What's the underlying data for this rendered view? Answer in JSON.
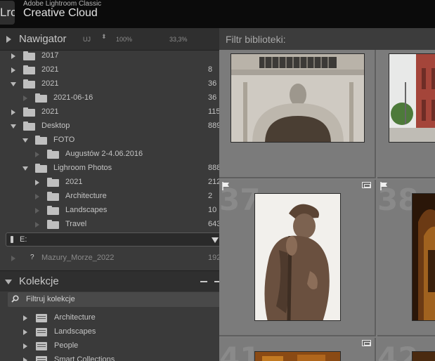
{
  "app": {
    "logo": "Lrc",
    "subtitle": "Adobe Lightroom Classic",
    "title": "Creative Cloud"
  },
  "navigator": {
    "title": "Nawigator",
    "fit": "UJ",
    "arrows": "⬍",
    "zoom1": "100%",
    "zoom2": "33,3%"
  },
  "folders": [
    {
      "label": "2017",
      "count": "",
      "level": 1,
      "expander": "collapsed"
    },
    {
      "label": "2021",
      "count": "8",
      "level": 1,
      "expander": "collapsed"
    },
    {
      "label": "2021",
      "count": "36",
      "level": 1,
      "expander": "expanded"
    },
    {
      "label": "2021-06-16",
      "count": "36",
      "level": 2,
      "expander": "none"
    },
    {
      "label": "2021",
      "count": "115",
      "level": 1,
      "expander": "collapsed"
    },
    {
      "label": "Desktop",
      "count": "889",
      "level": 1,
      "expander": "expanded"
    },
    {
      "label": "FOTO",
      "count": "",
      "level": 2,
      "expander": "expanded"
    },
    {
      "label": "Augustów 2-4.06.2016",
      "count": "",
      "level": 3,
      "expander": "none"
    },
    {
      "label": "Lighroom Photos",
      "count": "888",
      "level": 2,
      "expander": "expanded"
    },
    {
      "label": "2021",
      "count": "212",
      "level": 3,
      "expander": "collapsed"
    },
    {
      "label": "Architecture",
      "count": "2",
      "level": 3,
      "expander": "none"
    },
    {
      "label": "Landscapes",
      "count": "10",
      "level": 3,
      "expander": "none"
    },
    {
      "label": "Travel",
      "count": "643",
      "level": 3,
      "expander": "none"
    }
  ],
  "volume": {
    "label": "E:"
  },
  "missing_folder": {
    "label": "Mazury_Morze_2022",
    "count": "192"
  },
  "collections": {
    "title": "Kolekcje",
    "filter_label": "Filtruj kolekcje",
    "items": [
      "Architecture",
      "Landscapes",
      "People",
      "Smart Collections"
    ]
  },
  "library": {
    "filter_title": "Filtr biblioteki:",
    "cell_numbers": [
      "37",
      "38",
      "41",
      "42"
    ]
  },
  "colors": {
    "panel": "#3a3a3a",
    "grid": "#7b7b7b",
    "topbar": "#0b0b0b"
  }
}
